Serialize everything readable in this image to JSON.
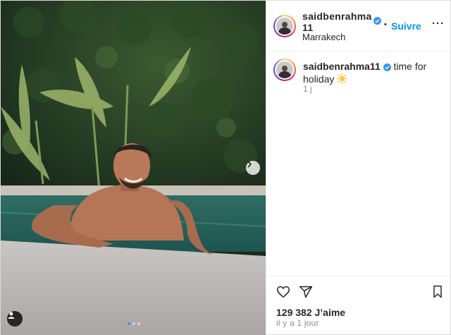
{
  "post": {
    "username_header": "saidbenrahma11",
    "location": "Marrakech",
    "follow_label": "Suivre",
    "separator": "•",
    "more_label": "···",
    "caption_username": "saidbenrahma11",
    "caption_text": "time for holiday",
    "caption_emoji": "sun-emoji",
    "caption_age": "1 j",
    "likes": "129 382 J’aime",
    "posted_ago": "il y a 1 jour"
  },
  "carousel": {
    "slide_count": 3,
    "active_index": 0
  },
  "colors": {
    "accent": "#0095f6",
    "verified": "#3897f0",
    "text": "#262626",
    "muted": "#8e8e8e"
  },
  "icons": [
    "verified-icon",
    "next-arrow-icon",
    "user-tag-icon",
    "heart-icon",
    "share-icon",
    "bookmark-icon",
    "more-icon"
  ]
}
